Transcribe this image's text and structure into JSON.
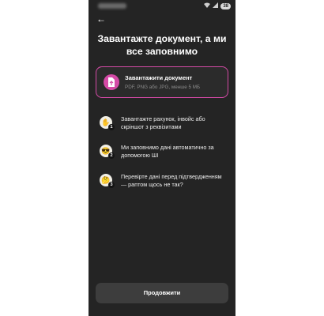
{
  "status": {
    "battery": "38"
  },
  "header": {
    "back_glyph": "←",
    "title": "Завантажте документ, а ми все заповнимо"
  },
  "upload": {
    "label": "Завантажити документ",
    "sub": "PDF, PNG або JPG, менше 5 МБ",
    "icon": "document-upload-icon",
    "accent": "#d44aa6"
  },
  "steps": [
    {
      "num": "1",
      "text": "Завантажте рахунок, інвойс або скріншот з реквізитами",
      "icon": "hand-emoji-icon"
    },
    {
      "num": "2",
      "text": "Ми заповнимо дані автоматично за допомогою ШІ",
      "icon": "cool-face-emoji-icon"
    },
    {
      "num": "3",
      "text": "Перевірте дані перед підтвердженням — раптом щось не так?",
      "icon": "thinking-face-emoji-icon"
    }
  ],
  "cta": {
    "label": "Продовжити"
  }
}
